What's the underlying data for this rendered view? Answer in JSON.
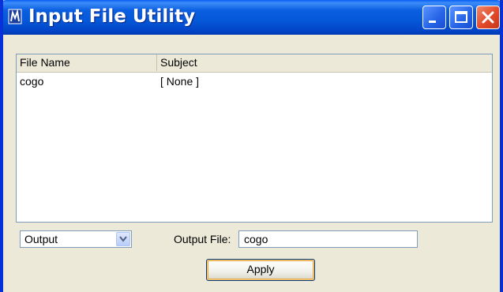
{
  "window": {
    "title": "Input File Utility"
  },
  "list": {
    "columns": [
      "File Name",
      "Subject"
    ],
    "rows": [
      {
        "file_name": "cogo",
        "subject": "[ None ]"
      }
    ]
  },
  "mode_select": {
    "value": "Output"
  },
  "output_file": {
    "label": "Output File:",
    "value": "cogo"
  },
  "apply_button": {
    "label": "Apply"
  },
  "colors": {
    "titlebar": "#0558d8",
    "window_face": "#ece9d8",
    "close_button": "#e1492a"
  }
}
